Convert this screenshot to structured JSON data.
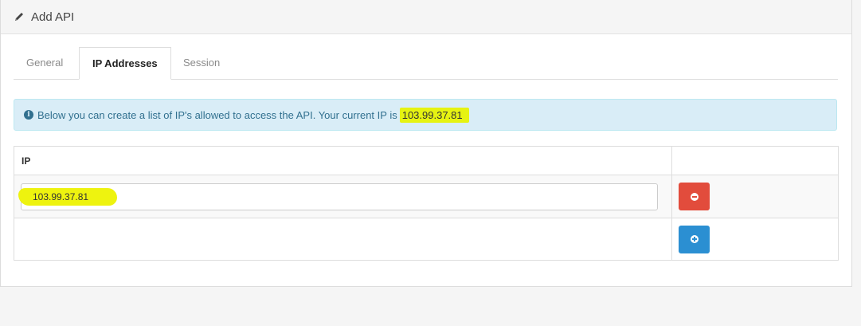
{
  "panel": {
    "title": "Add API",
    "title_icon": "pencil-icon"
  },
  "tabs": [
    {
      "label": "General",
      "active": false
    },
    {
      "label": "IP Addresses",
      "active": true
    },
    {
      "label": "Session",
      "active": false
    }
  ],
  "alert": {
    "icon": "info-circle-icon",
    "icon_glyph": "i",
    "text": "Below you can create a list of IP's allowed to access the API. Your current IP is",
    "current_ip": "103.99.37.81"
  },
  "table": {
    "columns": [
      "IP",
      ""
    ],
    "rows": [
      {
        "ip_value": "103.99.37.81",
        "action": "remove",
        "action_icon": "minus-circle-icon"
      }
    ],
    "add_action_icon": "plus-circle-icon"
  },
  "colors": {
    "danger": "#e24c3c",
    "primary": "#2b8fd2",
    "info_bg": "#d9edf7",
    "info_text": "#31708f",
    "highlight": "#e6f312"
  }
}
